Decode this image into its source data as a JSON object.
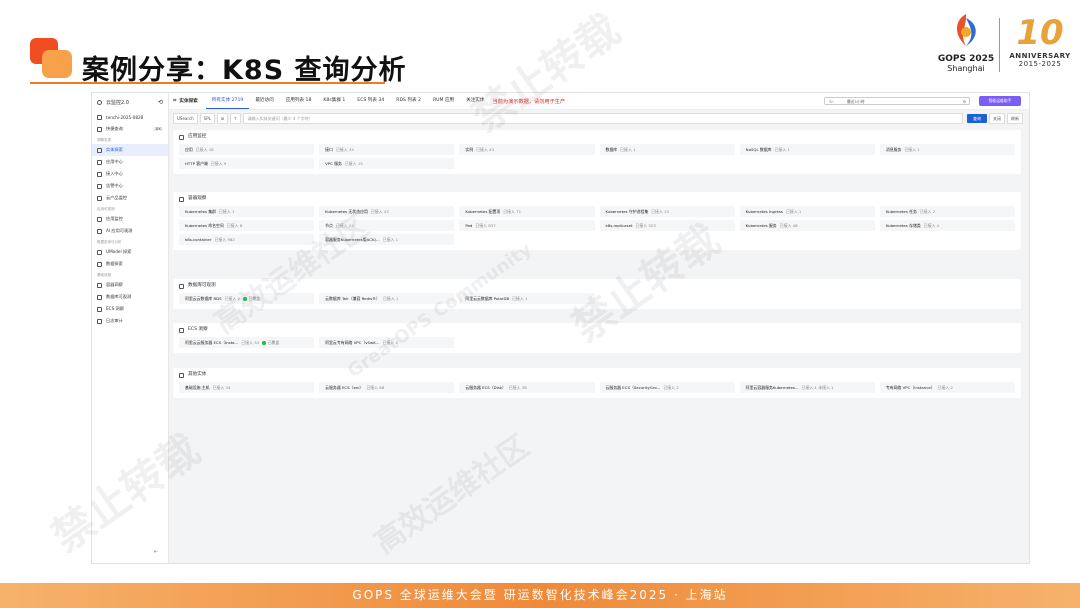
{
  "slide": {
    "title": "案例分享：K8S 查询分析",
    "footer": "GOPS 全球运维大会暨 研运数智化技术峰会2025 · 上海站",
    "gops_name": "GOPS 2025",
    "gops_city": "Shanghai",
    "anniv_num": "10",
    "anniv_word": "ANNIVERSARY",
    "anniv_years": "2015-2025",
    "watermark_a": "禁止转载",
    "watermark_b": "高效运维社区",
    "watermark_c": "GreatOPS Community"
  },
  "sidebar": {
    "brand": "云监控2.0",
    "workspace": "tenchi-2025-0828",
    "items": [
      {
        "label": "快捷查询",
        "badge": "⌘K"
      },
      {
        "section": "洞察发现"
      },
      {
        "label": "实体探索",
        "active": true
      },
      {
        "label": "应用中心"
      },
      {
        "label": "接入中心"
      },
      {
        "label": "告警中心"
      },
      {
        "label": "云产品监控"
      },
      {
        "section": "应用可观测"
      },
      {
        "label": "应用监控"
      },
      {
        "label": "AI 应用可观测"
      },
      {
        "section": "数据查询与分析"
      },
      {
        "label": "UModel 探索"
      },
      {
        "label": "数据探索"
      },
      {
        "section": "基础设施"
      },
      {
        "label": "容器洞察"
      },
      {
        "label": "数据库可观测"
      },
      {
        "label": "ECS 洞察"
      },
      {
        "label": "日志审计"
      }
    ]
  },
  "topbar": {
    "section": "实体探索",
    "tabs": [
      "所有实体 2719",
      "最近访问",
      "应用列表 18",
      "K8s集群 1",
      "ECS 列表 34",
      "RDS 列表 2",
      "RUM 应用",
      "关注实体"
    ],
    "notice": "当前为演示数据，请勿用于生产",
    "time_prefix": "5h",
    "time_label": "最近1小时",
    "assistant": "智能运维助手"
  },
  "search": {
    "mode": "USearch",
    "lang": "SPL",
    "placeholder": "请输入实体关键词（最少 4 个字符）",
    "search_btn": "查询",
    "btn_a": "关闭",
    "btn_b": "刷新"
  },
  "groups": [
    {
      "title": "应用监控",
      "items": [
        {
          "name": "应用",
          "sub": "已接入 18"
        },
        {
          "name": "接口",
          "sub": "已接入 34"
        },
        {
          "name": "实例",
          "sub": "已接入 43"
        },
        {
          "name": "数据库",
          "sub": "已接入 1"
        },
        {
          "name": "NoSQL 数据库",
          "sub": "已接入 1"
        },
        {
          "name": "消息服务",
          "sub": "已接入 1"
        },
        {
          "name": "HTTP 客户端",
          "sub": "已接入 9"
        },
        {
          "name": "VPC 服务",
          "sub": "已接入 15"
        }
      ]
    },
    {
      "title": "容器观察",
      "items": [
        {
          "name": "Kubernetes 集群",
          "sub": "已接入 1"
        },
        {
          "name": "Kubernetes 无状态应用",
          "sub": "已接入 43"
        },
        {
          "name": "Kubernetes 配置项",
          "sub": "已接入 71"
        },
        {
          "name": "Kubernetes 守护进程集",
          "sub": "已接入 15"
        },
        {
          "name": "Kubernetes Ingress",
          "sub": "已接入 1"
        },
        {
          "name": "Kubernetes 任务",
          "sub": "已接入 2"
        },
        {
          "name": "Kubernetes 命名空间",
          "sub": "已接入 8"
        },
        {
          "name": "节点",
          "sub": "已接入 24"
        },
        {
          "name": "Pod",
          "sub": "已接入 837"
        },
        {
          "name": "k8s.replicaset",
          "sub": "已接入 523"
        },
        {
          "name": "Kubernetes 服务",
          "sub": "已接入 48"
        },
        {
          "name": "Kubernetes 存储类",
          "sub": "已接入 4"
        },
        {
          "name": "k8s.container",
          "sub": "已接入 982"
        },
        {
          "name": "容器服务Kubernetes版ACK(...",
          "sub": "已接入 1"
        }
      ]
    },
    {
      "title": "数据库可观测",
      "items": [
        {
          "name": "阿里云云数据库 RDS",
          "sub": "已接入 2",
          "status": "已覆盖"
        },
        {
          "name": "云数据库 Tair（兼容 Redis®）",
          "sub": "已接入 1"
        },
        {
          "name": "阿里云云数据库 PolarDB",
          "sub": "已接入 1"
        }
      ]
    },
    {
      "title": "ECS 洞察",
      "items": [
        {
          "name": "阿里云云服务器 ECS（Insta...",
          "sub": "已接入 34",
          "status": "已覆盖"
        },
        {
          "name": "阿里云专有网络 VPC（vSwit...",
          "sub": "已接入 4"
        }
      ]
    },
    {
      "title": "其他实体",
      "items": [
        {
          "name": "基础设施.主机",
          "sub": "已接入 34"
        },
        {
          "name": "云服务器 ECS（eni）",
          "sub": "已接入 68"
        },
        {
          "name": "云服务器 ECS（Disk）",
          "sub": "已接入 58"
        },
        {
          "name": "云服务器 ECS（SecurityGro...",
          "sub": "已接入 2"
        },
        {
          "name": "阿里云容器服务Kubernetes...",
          "sub": "已接入 1 未接入 1"
        },
        {
          "name": "专有网络 VPC（instance）",
          "sub": "已接入 2"
        }
      ]
    }
  ]
}
